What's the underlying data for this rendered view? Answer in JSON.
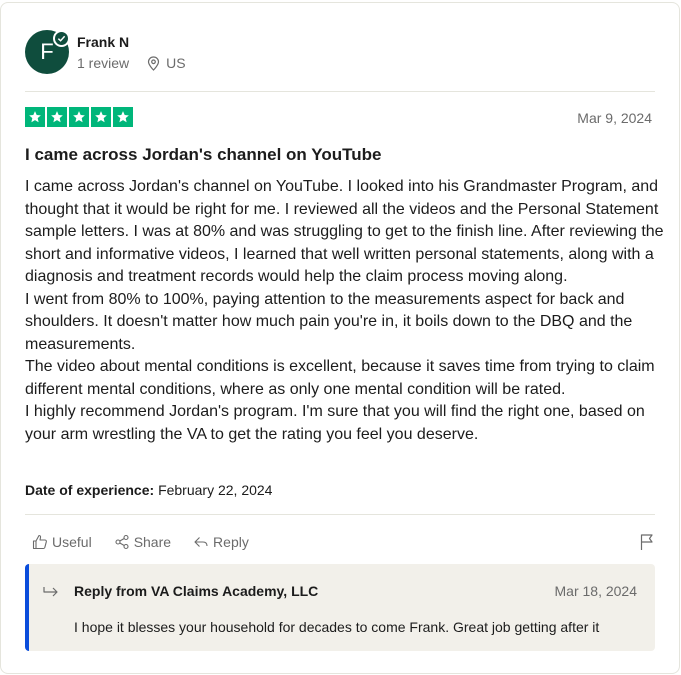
{
  "reviewer": {
    "initial": "F",
    "name": "Frank N",
    "review_count": "1 review",
    "location": "US"
  },
  "review": {
    "rating": 5,
    "date": "Mar 9, 2024",
    "title": "I came across Jordan's channel on YouTube",
    "paragraphs": [
      "I came across Jordan's channel on YouTube. I looked into his Grandmaster Program, and thought that it would be right for me. I reviewed all the videos and the Personal Statement sample letters. I was at 80% and was struggling to get to the finish line. After reviewing the short and informative videos, I learned that well written personal statements, along with a diagnosis and treatment records would help the claim process moving along.",
      "I went from 80% to 100%, paying attention to the measurements aspect for back and shoulders. It doesn't matter how much pain you're in, it boils down to the DBQ and the measurements.",
      "The video about mental conditions is excellent, because it saves time from trying to claim different mental conditions, where as only one mental condition will be rated.",
      "I highly recommend Jordan's program. I'm sure that you will find the right one, based on your arm wrestling the VA to get the rating you feel you deserve."
    ],
    "experience_label": "Date of experience:",
    "experience_date": "February 22, 2024"
  },
  "actions": {
    "useful": "Useful",
    "share": "Share",
    "reply": "Reply"
  },
  "company_reply": {
    "title": "Reply from VA Claims Academy, LLC",
    "date": "Mar 18, 2024",
    "text": "I hope it blesses your household for decades to come Frank. Great job getting after it"
  },
  "colors": {
    "star_green": "#00b67a",
    "avatar_green": "#0f4d3d",
    "reply_accent": "#0a4ddb",
    "reply_bg": "#f2f0ea"
  }
}
